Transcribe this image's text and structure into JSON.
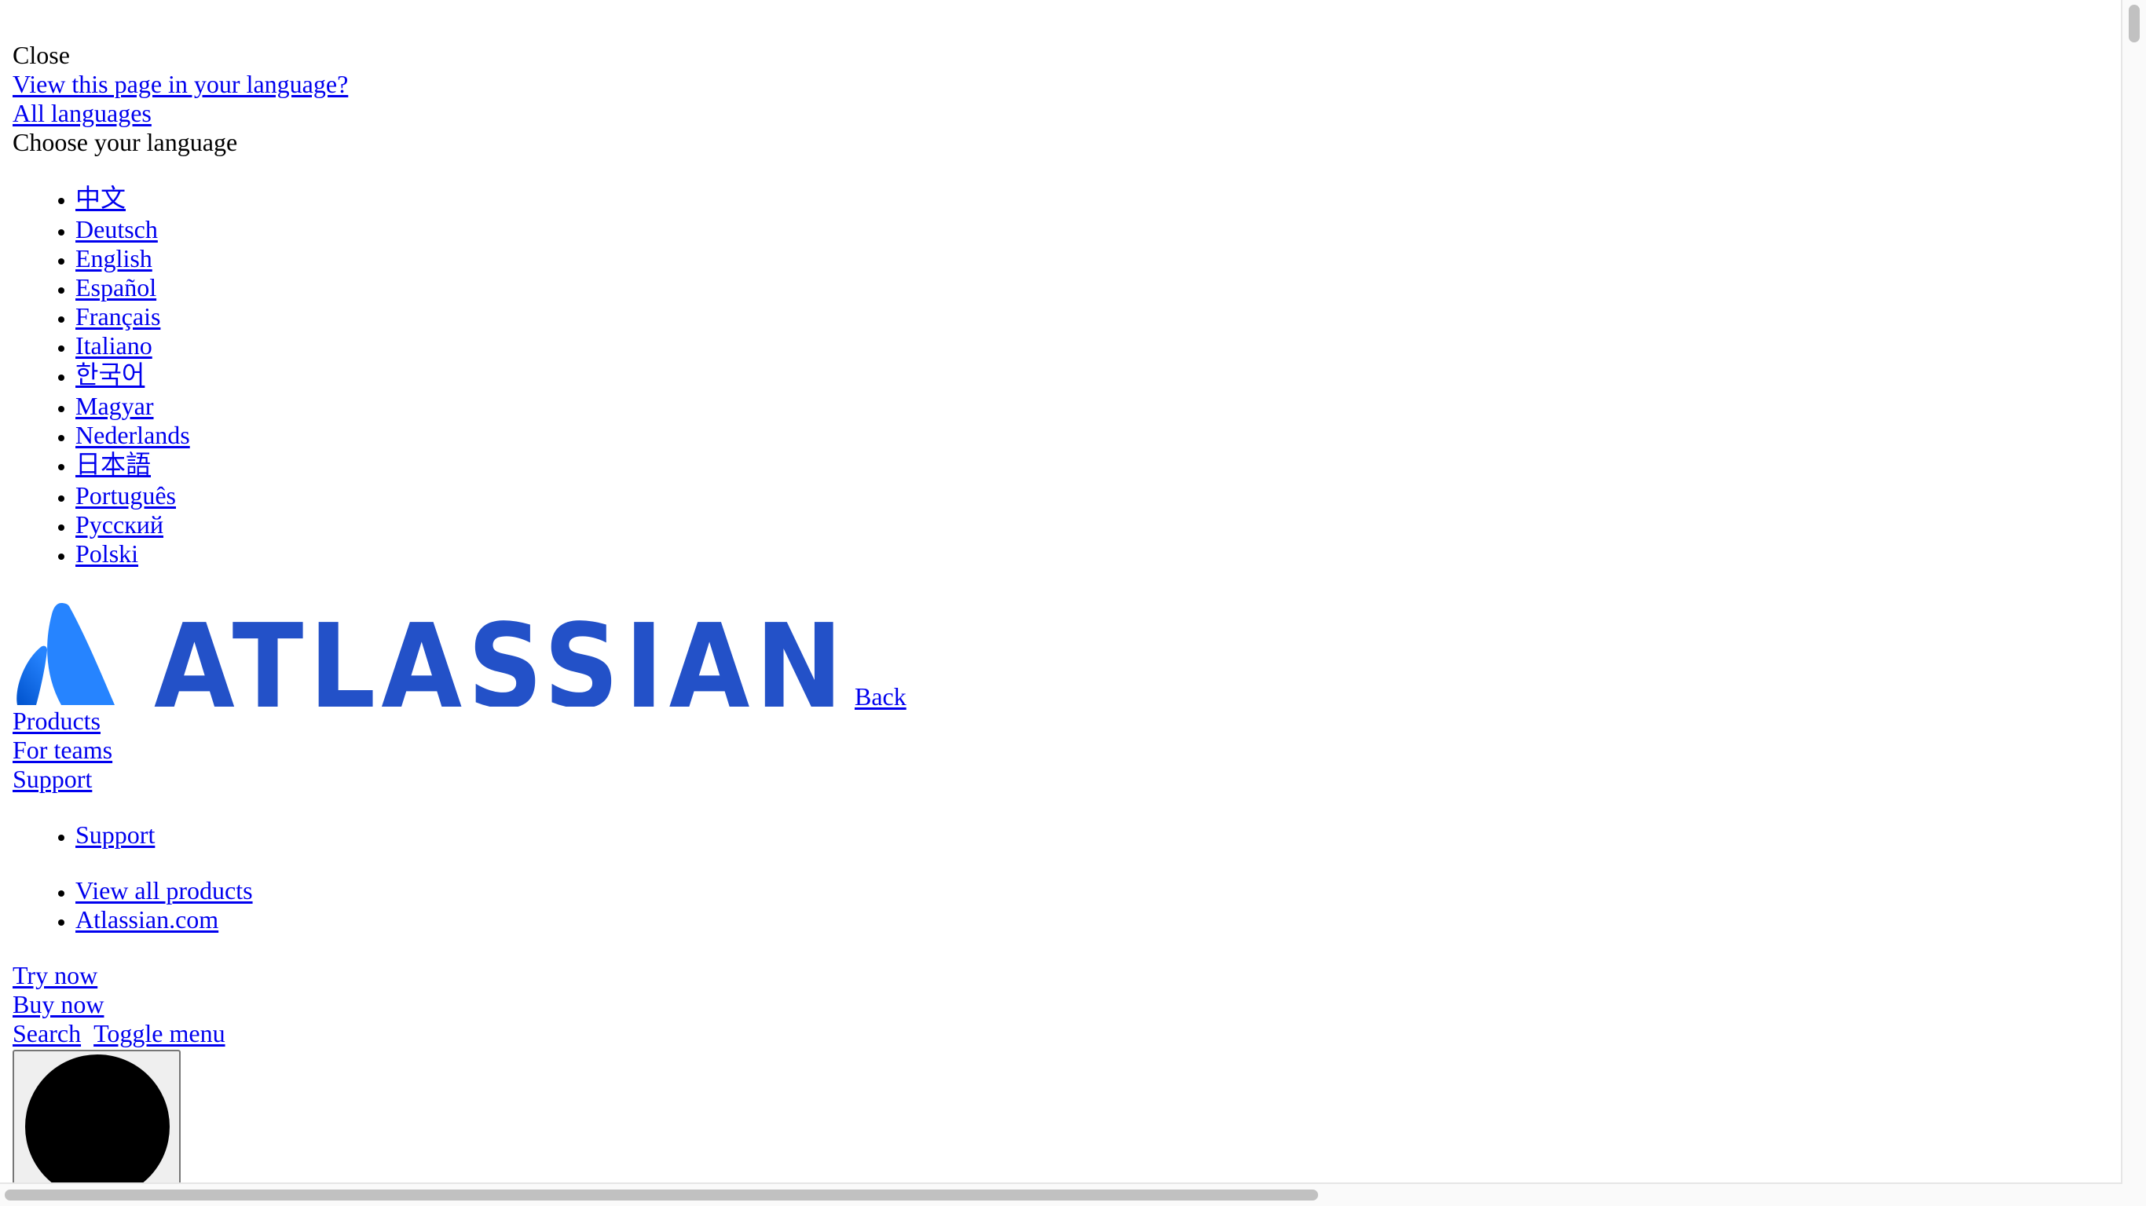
{
  "banner": {
    "close_label": "Close",
    "view_language_link": "View this page in your language?",
    "all_languages_link": "All languages",
    "choose_language_label": "Choose your language"
  },
  "languages": [
    "中文",
    "Deutsch",
    "English",
    "Español",
    "Français",
    "Italiano",
    "한국어",
    "Magyar",
    "Nederlands",
    "日本語",
    "Português",
    "Русский",
    "Polski"
  ],
  "header": {
    "logo_text": "ATLASSIAN",
    "logo_colors": {
      "mark_light": "#2684ff",
      "mark_dark": "#0052cc",
      "wordmark": "#2351c8"
    },
    "back_link": "Back",
    "nav": {
      "products": "Products",
      "for_teams": "For teams",
      "support": "Support"
    },
    "support_menu": [
      "Support"
    ],
    "product_links": [
      "View all products",
      "Atlassian.com"
    ],
    "try_now": "Try now",
    "buy_now": "Buy now",
    "search": "Search",
    "toggle_menu": "Toggle menu"
  },
  "colors": {
    "link": "#0000ee",
    "text": "#000000",
    "button_bg": "#efefef"
  }
}
